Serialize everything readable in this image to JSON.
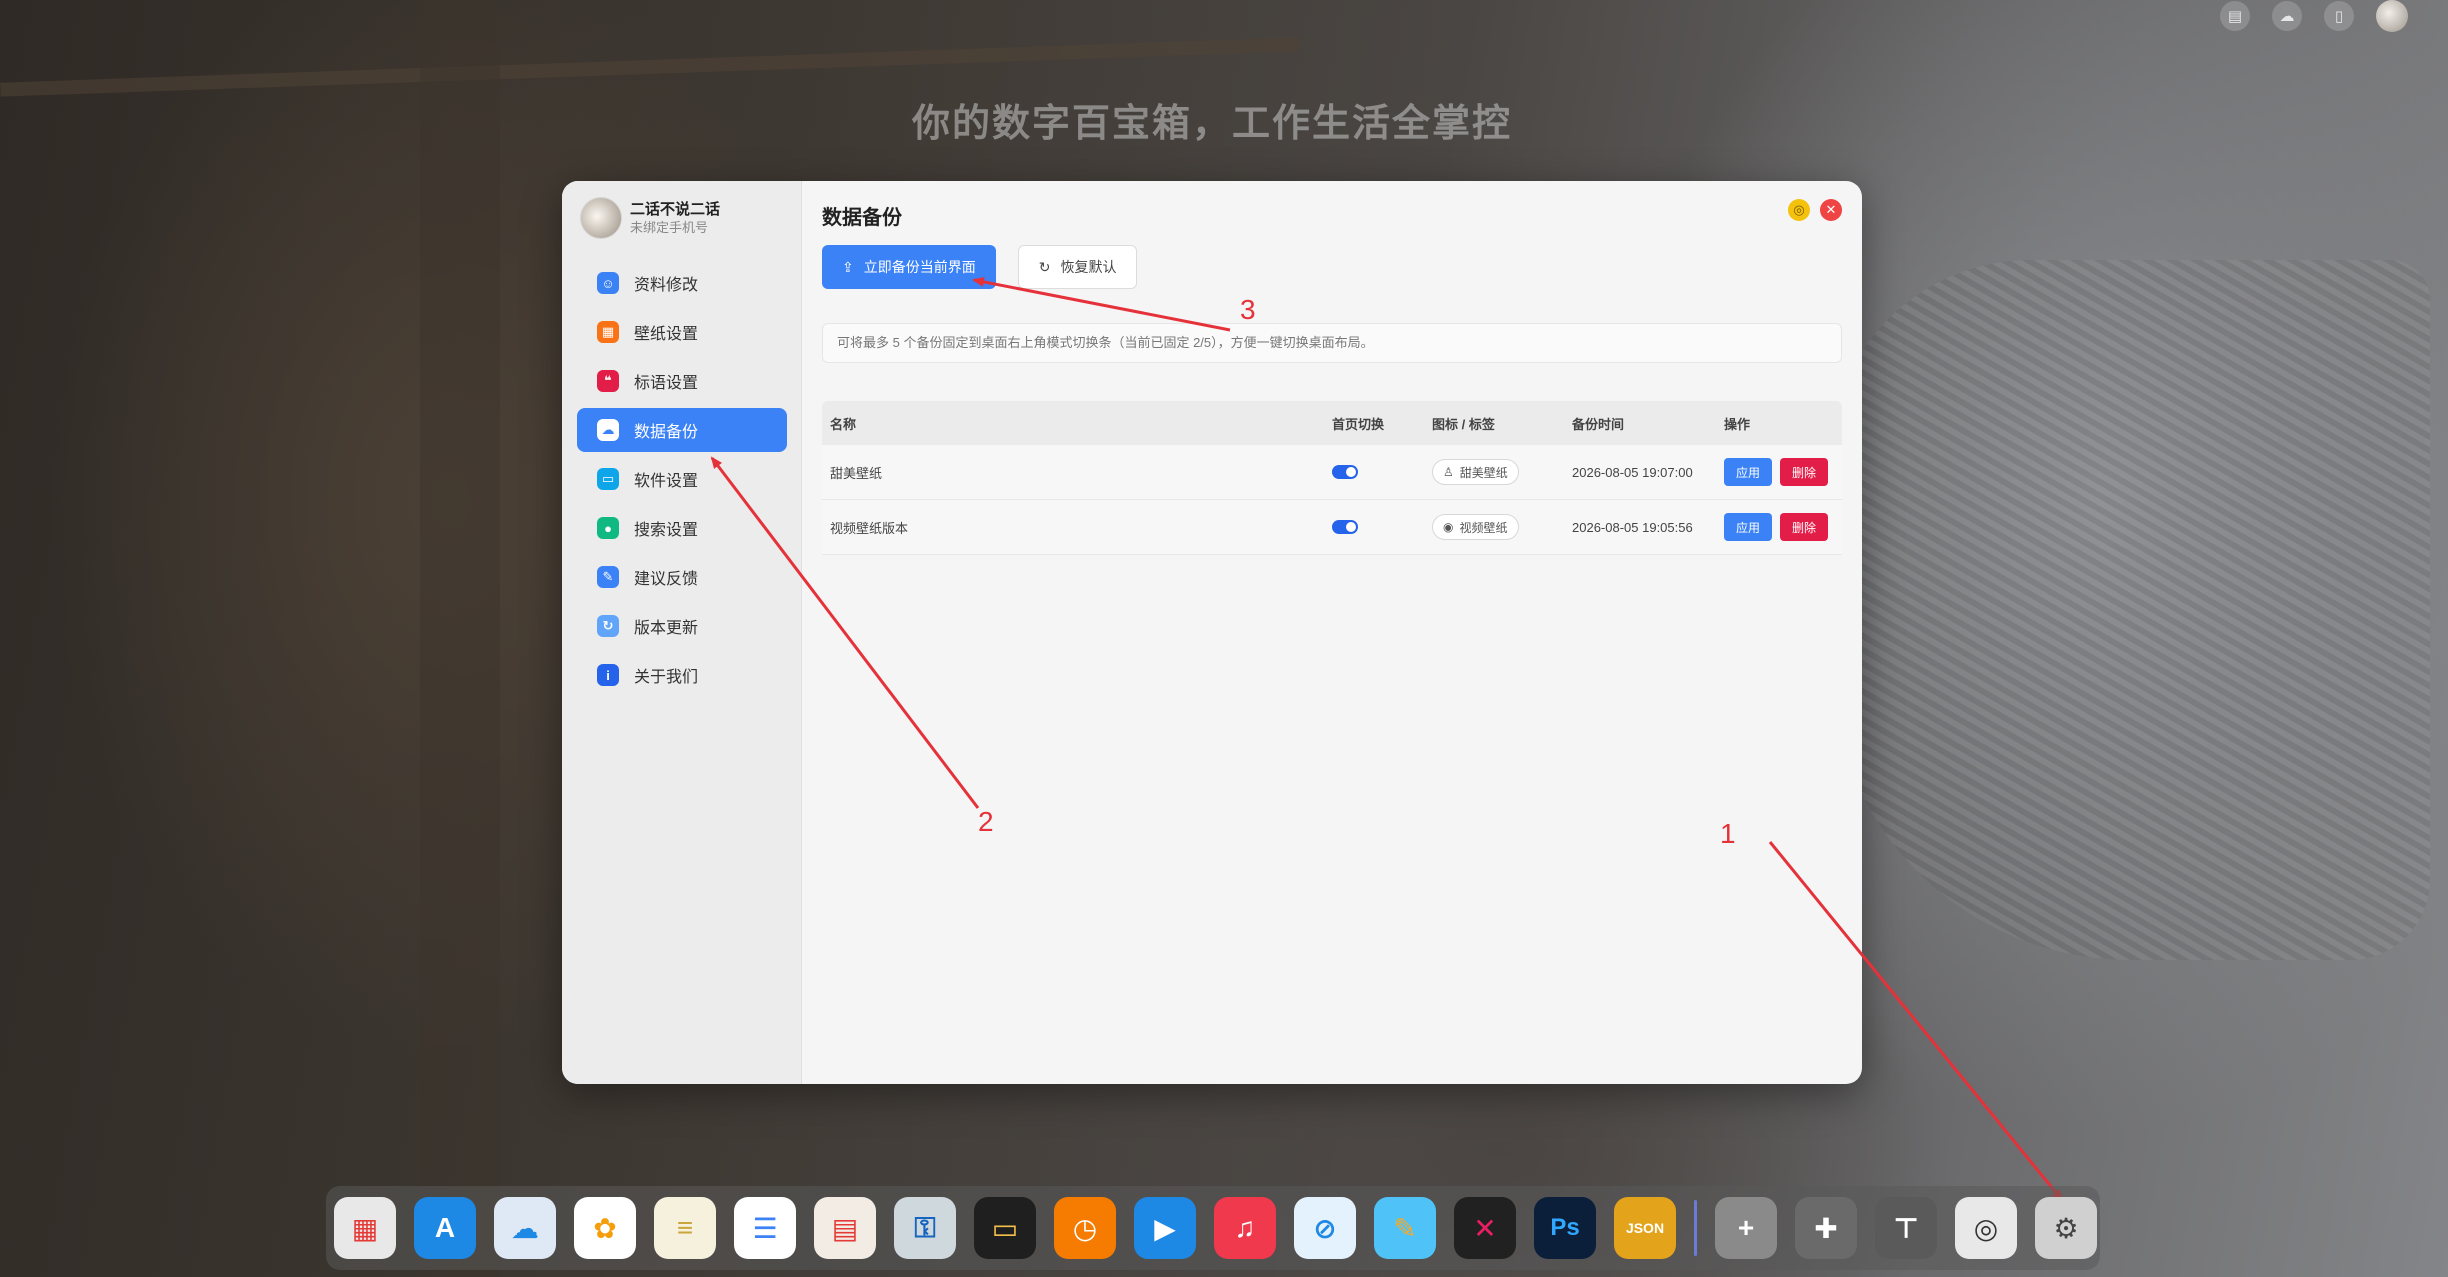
{
  "desktop": {
    "slogan": "你的数字百宝箱，工作生活全掌控"
  },
  "profile": {
    "name": "二话不说二话",
    "subtitle": "未绑定手机号"
  },
  "sidebar": {
    "items": [
      {
        "label": "资料修改",
        "icon": "user-card-icon",
        "color": "#3b82f6"
      },
      {
        "label": "壁纸设置",
        "icon": "wallpaper-icon",
        "color": "#f97316"
      },
      {
        "label": "标语设置",
        "icon": "quote-icon",
        "color": "#e11d48"
      },
      {
        "label": "数据备份",
        "icon": "cloud-icon",
        "color": "#ffffff",
        "active": true
      },
      {
        "label": "软件设置",
        "icon": "monitor-icon",
        "color": "#0ea5e9"
      },
      {
        "label": "搜索设置",
        "icon": "search-icon",
        "color": "#10b981"
      },
      {
        "label": "建议反馈",
        "icon": "feedback-icon",
        "color": "#3b82f6"
      },
      {
        "label": "版本更新",
        "icon": "update-icon",
        "color": "#60a5fa"
      },
      {
        "label": "关于我们",
        "icon": "info-icon",
        "color": "#2563eb"
      }
    ]
  },
  "main": {
    "title": "数据备份",
    "backup_button": "立即备份当前界面",
    "restore_button": "恢复默认",
    "notice": "可将最多 5 个备份固定到桌面右上角模式切换条（当前已固定 2/5），方便一键切换桌面布局。",
    "table": {
      "headers": [
        "名称",
        "首页切换",
        "图标 / 标签",
        "备份时间",
        "操作"
      ],
      "rows": [
        {
          "name": "甜美壁纸",
          "toggle_on": true,
          "tag": "甜美壁纸",
          "tag_icon": "person-icon",
          "time": "2026-08-05 19:07:00",
          "apply": "应用",
          "delete": "删除"
        },
        {
          "name": "视频壁纸版本",
          "toggle_on": true,
          "tag": "视频壁纸",
          "tag_icon": "camera-icon",
          "time": "2026-08-05 19:05:56",
          "apply": "应用",
          "delete": "删除"
        }
      ]
    }
  },
  "annotations": {
    "one": "1",
    "two": "2",
    "three": "3",
    "color": "#e5323a"
  },
  "dock": {
    "items": [
      {
        "icon": "launchpad-icon",
        "color": "#e8e8e8"
      },
      {
        "icon": "app-store-icon",
        "color": "#1e88e5"
      },
      {
        "icon": "icloud-icon",
        "color": "#dfe9f5"
      },
      {
        "icon": "photos-icon",
        "color": "#ffffff"
      },
      {
        "icon": "notes-icon",
        "color": "#f6f1dc"
      },
      {
        "icon": "reminders-icon",
        "color": "#ffffff"
      },
      {
        "icon": "calendar-icon",
        "color": "#f3ece4"
      },
      {
        "icon": "keychain-icon",
        "color": "#cfd8dc"
      },
      {
        "icon": "wallet-icon",
        "color": "#1f1f1f"
      },
      {
        "icon": "clock-icon",
        "color": "#f57c00"
      },
      {
        "icon": "play-icon",
        "color": "#1e88e5"
      },
      {
        "icon": "music-icon",
        "color": "#f0394c"
      },
      {
        "icon": "safari-icon",
        "color": "#e3f2fd"
      },
      {
        "icon": "pencil-icon",
        "color": "#4fc3f7"
      },
      {
        "icon": "code-icon",
        "color": "#212121"
      },
      {
        "icon": "photoshop-icon",
        "color": "#0b1f3a"
      },
      {
        "icon": "json-icon",
        "color": "#e3a31a"
      },
      {
        "icon": "add-icon",
        "color": "#8a8a8a"
      },
      {
        "icon": "puzzle-icon",
        "color": "#6a6a6a"
      },
      {
        "icon": "brush-icon",
        "color": "#5a5a5a"
      },
      {
        "icon": "camera-settings-icon",
        "color": "#e8e8e8"
      },
      {
        "icon": "settings-icon",
        "color": "#d0d0d0"
      }
    ],
    "labels": {
      "photoshop": "Ps",
      "json": "JSON"
    }
  }
}
